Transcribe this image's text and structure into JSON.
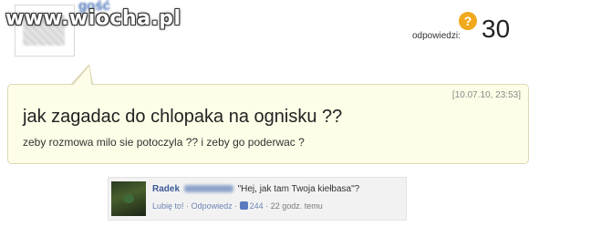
{
  "watermark": {
    "text": "www.wiocha.pl"
  },
  "question": {
    "author_name": "gość",
    "answers_label": "odpowiedzi:",
    "answers_count": "30",
    "timestamp": "[10.07.10, 23:53]",
    "title": "jak zagadac do chlopaka na ognisku ??",
    "body": "zeby rozmowa milo sie potoczyla ?? i zeby go poderwac ?"
  },
  "comment": {
    "author": "Radek",
    "text": "\"Hej, jak tam Twoja kiełbasa\"?",
    "like_link": "Lubię to!",
    "separator": "·",
    "reply_link": "Odpowiedz",
    "likes": "244",
    "time": "22 godz. temu"
  },
  "icons": {
    "answers": "answers-bubble-icon",
    "like": "thumbs-up-icon"
  },
  "colors": {
    "question_bg": "#fefde7",
    "answers_icon": "#f0a81c",
    "fb_link": "#3b5998"
  }
}
